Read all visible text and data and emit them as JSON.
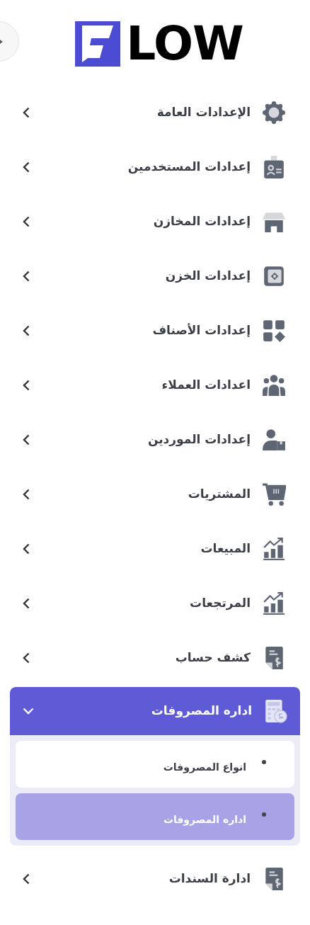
{
  "logo": {
    "text": "LOW"
  },
  "menu": [
    {
      "label": "الإعدادات العامة",
      "expanded": false
    },
    {
      "label": "إعدادات المستخدمين",
      "expanded": false
    },
    {
      "label": "إعدادات المخازن",
      "expanded": false
    },
    {
      "label": "إعدادات الخزن",
      "expanded": false
    },
    {
      "label": "إعدادات الأصناف",
      "expanded": false
    },
    {
      "label": "اعدادات العملاء",
      "expanded": false
    },
    {
      "label": "إعدادات الموردين",
      "expanded": false
    },
    {
      "label": "المشتريات",
      "expanded": false
    },
    {
      "label": "المبيعات",
      "expanded": false
    },
    {
      "label": "المرتجعات",
      "expanded": false
    },
    {
      "label": "كشف حساب",
      "expanded": false
    },
    {
      "label": "اداره المصروفات",
      "expanded": true,
      "children": [
        {
          "label": "انواع المصروفات",
          "selected": false
        },
        {
          "label": "اداره المصروفات",
          "selected": true
        }
      ]
    },
    {
      "label": "ادارة السندات",
      "expanded": false
    }
  ]
}
